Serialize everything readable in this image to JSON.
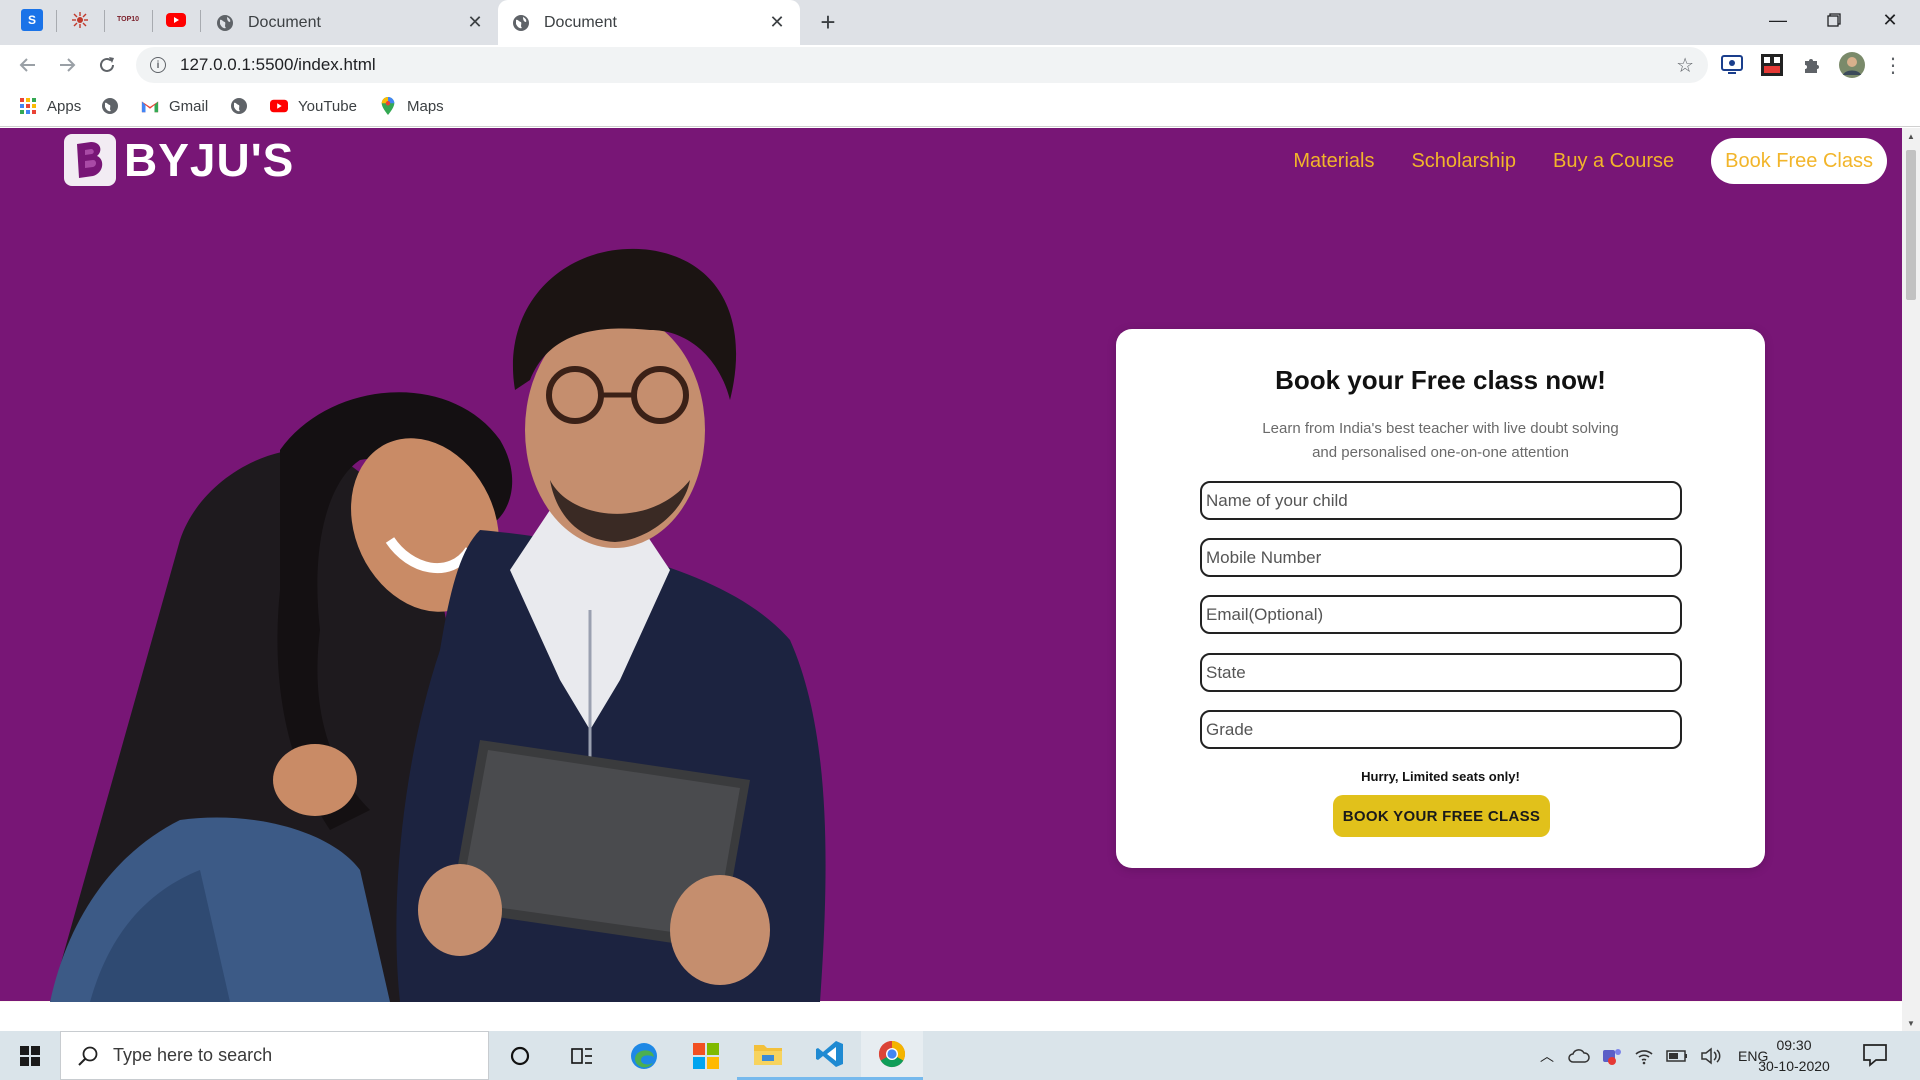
{
  "browser": {
    "pinned_tabs": [
      {
        "name": "pinned-tab-s",
        "letter": "S"
      },
      {
        "name": "pinned-tab-spark",
        "letter": ""
      },
      {
        "name": "pinned-tab-top10",
        "letter": "TOP10"
      },
      {
        "name": "pinned-tab-youtube",
        "letter": ""
      }
    ],
    "tabs": [
      {
        "title": "Document",
        "active": false
      },
      {
        "title": "Document",
        "active": true
      }
    ],
    "address": "127.0.0.1:5500/index.html",
    "bookmarks": [
      {
        "label": "Apps"
      },
      {
        "label": ""
      },
      {
        "label": "Gmail"
      },
      {
        "label": ""
      },
      {
        "label": "YouTube"
      },
      {
        "label": "Maps"
      }
    ]
  },
  "site": {
    "logo_text": "BYJU'S",
    "nav": {
      "materials": "Materials",
      "scholarship": "Scholarship",
      "buy_course": "Buy a Course",
      "book_free": "Book Free Class"
    },
    "form": {
      "title": "Book your Free class now!",
      "subtitle_line1": "Learn from India's best teacher with live doubt solving",
      "subtitle_line2": "and personalised one-on-one attention",
      "fields": {
        "child_name": "Name of your child",
        "mobile": "Mobile Number",
        "email": "Email(Optional)",
        "state": "State",
        "grade": "Grade"
      },
      "hurry_text": "Hurry, Limited seats only!",
      "submit_label": "BOOK YOUR FREE CLASS"
    },
    "colors": {
      "hero_bg": "#781676",
      "nav_accent": "#f2b52a",
      "cta_bg": "#e1c11b"
    }
  },
  "taskbar": {
    "search_placeholder": "Type here to search",
    "language": "ENG",
    "time": "09:30",
    "date": "30-10-2020"
  }
}
